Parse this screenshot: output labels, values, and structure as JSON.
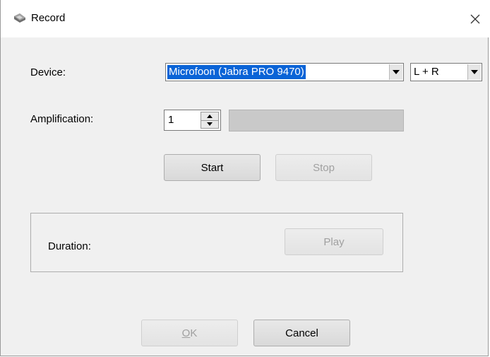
{
  "window": {
    "title": "Record",
    "icon": "microphone-icon",
    "close_glyph": "✕"
  },
  "device": {
    "label": "Device:",
    "selected": "Microfoon (Jabra PRO 9470)",
    "channel": "L + R"
  },
  "amplification": {
    "label": "Amplification:",
    "value": "1",
    "level_fraction": 0
  },
  "controls": {
    "start": "Start",
    "stop": "Stop"
  },
  "duration": {
    "label": "Duration:",
    "play": "Play"
  },
  "footer": {
    "ok_prefix": "",
    "ok_mnemonic": "O",
    "ok_rest": "K",
    "cancel": "Cancel"
  },
  "colors": {
    "selection": "#0a64d7",
    "dialog_bg": "#f0f0f0",
    "meter_bg": "#c9c9c9"
  }
}
